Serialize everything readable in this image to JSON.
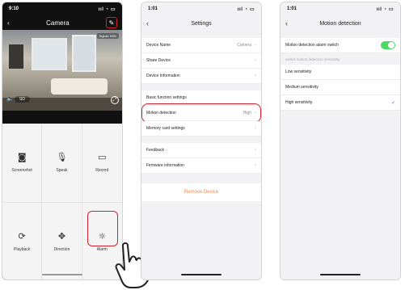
{
  "phone1": {
    "status_time": "9:10",
    "status_signal": "..ıl ᯤ",
    "title": "Camera",
    "signal_tag": "Signal: 63%",
    "sd_label": "SD",
    "controls": [
      {
        "label": "Screenshot",
        "icon": "camera-icon"
      },
      {
        "label": "Speak",
        "icon": "microphone-icon"
      },
      {
        "label": "Record",
        "icon": "video-record-icon"
      },
      {
        "label": "Playback",
        "icon": "playback-icon"
      },
      {
        "label": "Direction",
        "icon": "direction-arrows-icon"
      },
      {
        "label": "Alarm",
        "icon": "alarm-light-icon"
      }
    ]
  },
  "phone2": {
    "status_time": "1:01",
    "title": "Settings",
    "rows_group1": [
      {
        "label": "Device Name",
        "value": "Camera"
      },
      {
        "label": "Share Device",
        "value": ""
      },
      {
        "label": "Device Information",
        "value": ""
      }
    ],
    "section_basic": "Basic function settings",
    "motion_row": {
      "label": "Motion detection",
      "value": "High"
    },
    "memory_row": {
      "label": "Memory card settings",
      "value": ""
    },
    "rows_group3": [
      {
        "label": "Feedback",
        "value": ""
      },
      {
        "label": "Firmware information",
        "value": ""
      }
    ],
    "remove_label": "Remove Device"
  },
  "phone3": {
    "status_time": "1:01",
    "title": "Motion detection",
    "switch_label": "Motion detection alarm switch",
    "switch_on": true,
    "sensitivity_section": "Select motion detection sensitivity",
    "sensitivities": [
      "Low sensitivity",
      "Medium sensitivity",
      "High sensitivity"
    ],
    "selected": "High sensitivity"
  },
  "colors": {
    "highlight": "#d0212e",
    "toggle_on": "#4cd964",
    "remove": "#f08a4b",
    "check": "#3a7bd5"
  }
}
